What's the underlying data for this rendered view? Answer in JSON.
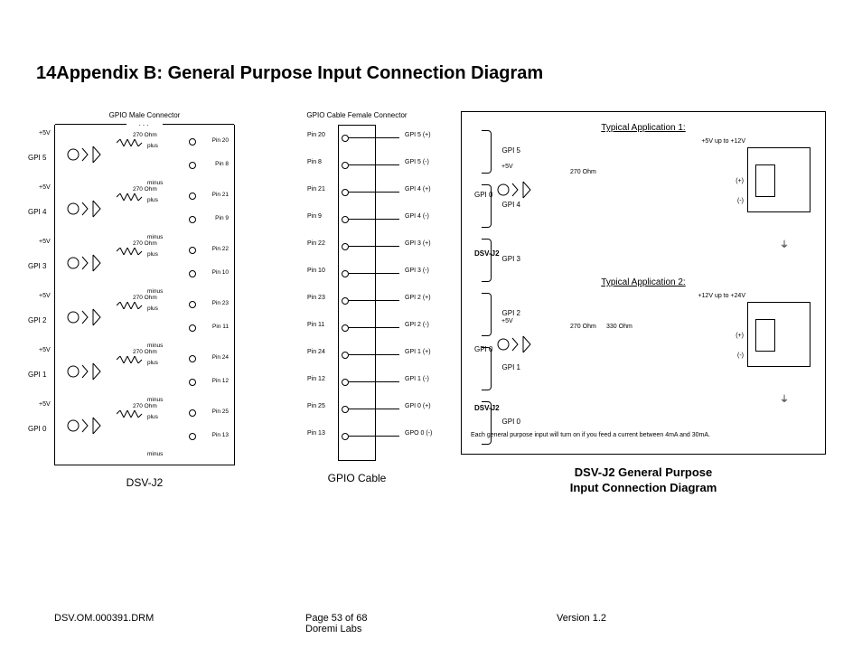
{
  "heading_num": "14",
  "heading": "Appendix B: General Purpose Input Connection Diagram",
  "left": {
    "connector_title": "GPIO Male Connector",
    "caption": "DSV-J2",
    "supply": "+5V",
    "resistor": "270 Ohm",
    "plus": "plus",
    "minus": "minus",
    "channels": [
      {
        "label": "GPI 5",
        "pin_plus": "Pin 20",
        "pin_minus": "Pin 8"
      },
      {
        "label": "GPI 4",
        "pin_plus": "Pin 21",
        "pin_minus": "Pin 9"
      },
      {
        "label": "GPI 3",
        "pin_plus": "Pin 22",
        "pin_minus": "Pin 10"
      },
      {
        "label": "GPI 2",
        "pin_plus": "Pin 23",
        "pin_minus": "Pin 11"
      },
      {
        "label": "GPI 1",
        "pin_plus": "Pin 24",
        "pin_minus": "Pin 12"
      },
      {
        "label": "GPI 0",
        "pin_plus": "Pin 25",
        "pin_minus": "Pin 13"
      }
    ]
  },
  "middle": {
    "connector_title": "GPIO Cable Female Connector",
    "caption": "GPIO Cable",
    "rows": [
      {
        "pin": "Pin 20",
        "label": "GPI 5 (+)"
      },
      {
        "pin": "Pin 8",
        "label": "GPI 5 (-)"
      },
      {
        "pin": "Pin 21",
        "label": "GPI 4  (+)"
      },
      {
        "pin": "Pin 9",
        "label": "GPI 4 (-)"
      },
      {
        "pin": "Pin 22",
        "label": "GPI 3 (+)"
      },
      {
        "pin": "Pin 10",
        "label": "GPI 3 (-)"
      },
      {
        "pin": "Pin 23",
        "label": "GPI 2 (+)"
      },
      {
        "pin": "Pin 11",
        "label": "GPI 2 (-)"
      },
      {
        "pin": "Pin 24",
        "label": "GPI 1 (+)"
      },
      {
        "pin": "Pin 12",
        "label": "GPI 1 (-)"
      },
      {
        "pin": "Pin 25",
        "label": "GPI 0 (+)"
      },
      {
        "pin": "Pin 13",
        "label": "GPO 0 (-)"
      }
    ],
    "groups": [
      "GPI 5",
      "GPI 4",
      "GPI 3",
      "GPI 2",
      "GPI 1",
      "GPI 0"
    ]
  },
  "right": {
    "app1": {
      "title": "Typical Application 1:",
      "vrange": "+5V up to +12V",
      "supply": "+5V",
      "resistor": "270 Ohm",
      "gpi": "GPI 0",
      "device": "DSV-J2",
      "plus": "(+)",
      "minus": "(-)"
    },
    "app2": {
      "title": "Typical Application 2:",
      "vrange": "+12V up to +24V",
      "supply": "+5V",
      "resistor": "270 Ohm",
      "resistor2": "330 Ohm",
      "gpi": "GPI 0",
      "device": "DSV-J2",
      "plus": "(+)",
      "minus": "(-)"
    },
    "footnote": "Each general purpose input will turn on if you feed a current between 4mA and 30mA.",
    "caption_l1": "DSV-J2 General Purpose",
    "caption_l2": "Input Connection Diagram"
  },
  "footer": {
    "left": "DSV.OM.000391.DRM",
    "center_l1": "Page 53 of 68",
    "center_l2": "Doremi Labs",
    "right": "Version 1.2"
  }
}
